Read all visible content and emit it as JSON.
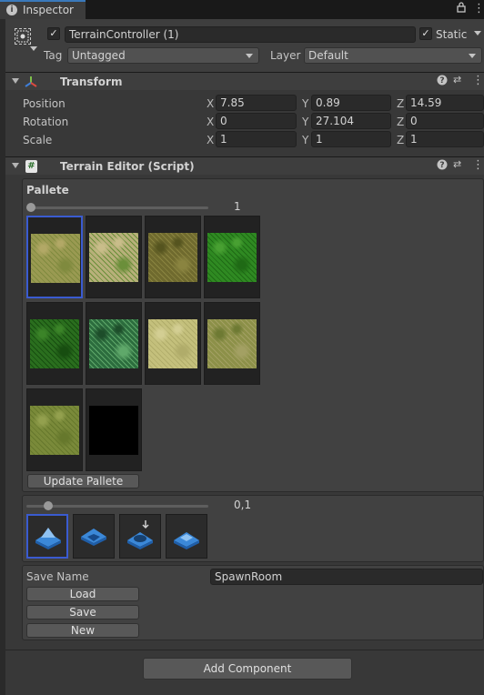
{
  "tab": {
    "label": "Inspector"
  },
  "object": {
    "active_checked": true,
    "name": "TerrainController (1)",
    "static_label": "Static",
    "static_checked": true,
    "tag_label": "Tag",
    "tag_value": "Untagged",
    "layer_label": "Layer",
    "layer_value": "Default"
  },
  "transform": {
    "title": "Transform",
    "rows": [
      {
        "label": "Position",
        "x": "7.85",
        "y": "0.89",
        "z": "14.59"
      },
      {
        "label": "Rotation",
        "x": "0",
        "y": "27.104",
        "z": "0"
      },
      {
        "label": "Scale",
        "x": "1",
        "y": "1",
        "z": "1"
      }
    ],
    "axis_x": "X",
    "axis_y": "Y",
    "axis_z": "Z"
  },
  "terrain_editor": {
    "title": "Terrain Editor (Script)",
    "pallete_label": "Pallete",
    "pallete_slider_value": "1",
    "pallete_slider_fraction": 0.0,
    "textures": [
      {
        "name": "grass-dirt",
        "colors": [
          "#9a9a52",
          "#7f8a3e",
          "#b2a866"
        ],
        "selected": true
      },
      {
        "name": "dirt-path-grass",
        "colors": [
          "#b8b07a",
          "#6b8f3a",
          "#c9bd8a"
        ],
        "selected": false
      },
      {
        "name": "dark-moss",
        "colors": [
          "#6f6a2e",
          "#8a8440",
          "#55541f"
        ],
        "selected": false
      },
      {
        "name": "green-grass",
        "colors": [
          "#2f8a22",
          "#1f6a15",
          "#48a032"
        ],
        "selected": false
      },
      {
        "name": "dense-grass",
        "colors": [
          "#2a6e1e",
          "#174d10",
          "#3b8428"
        ],
        "selected": false
      },
      {
        "name": "ornate-grass",
        "colors": [
          "#2c6d3e",
          "#5fa86a",
          "#1d4d2a"
        ],
        "selected": false
      },
      {
        "name": "light-sand",
        "colors": [
          "#c4c07c",
          "#b0ac6a",
          "#d3ce93"
        ],
        "selected": false
      },
      {
        "name": "stone-grass",
        "colors": [
          "#8c9048",
          "#a3a063",
          "#6e7a33"
        ],
        "selected": false
      },
      {
        "name": "olive-grass",
        "colors": [
          "#7a8a3a",
          "#66782c",
          "#93a04e"
        ],
        "selected": false
      },
      {
        "name": "black",
        "colors": [
          "#000000",
          "#000000",
          "#000000"
        ],
        "selected": false
      }
    ],
    "update_button": "Update Pallete",
    "brush_slider_value": "0,1",
    "brush_slider_fraction": 0.1,
    "tools": [
      {
        "name": "raise-terrain-icon",
        "selected": true
      },
      {
        "name": "lower-terrain-icon",
        "selected": false
      },
      {
        "name": "stamp-terrain-icon",
        "selected": false
      },
      {
        "name": "flatten-terrain-icon",
        "selected": false
      }
    ],
    "save_name_label": "Save Name",
    "save_name_value": "SpawnRoom",
    "load_button": "Load",
    "save_button": "Save",
    "new_button": "New"
  },
  "add_component_button": "Add Component",
  "colors": {
    "selection": "#3a5bd0",
    "accent": "#3a79bb"
  }
}
